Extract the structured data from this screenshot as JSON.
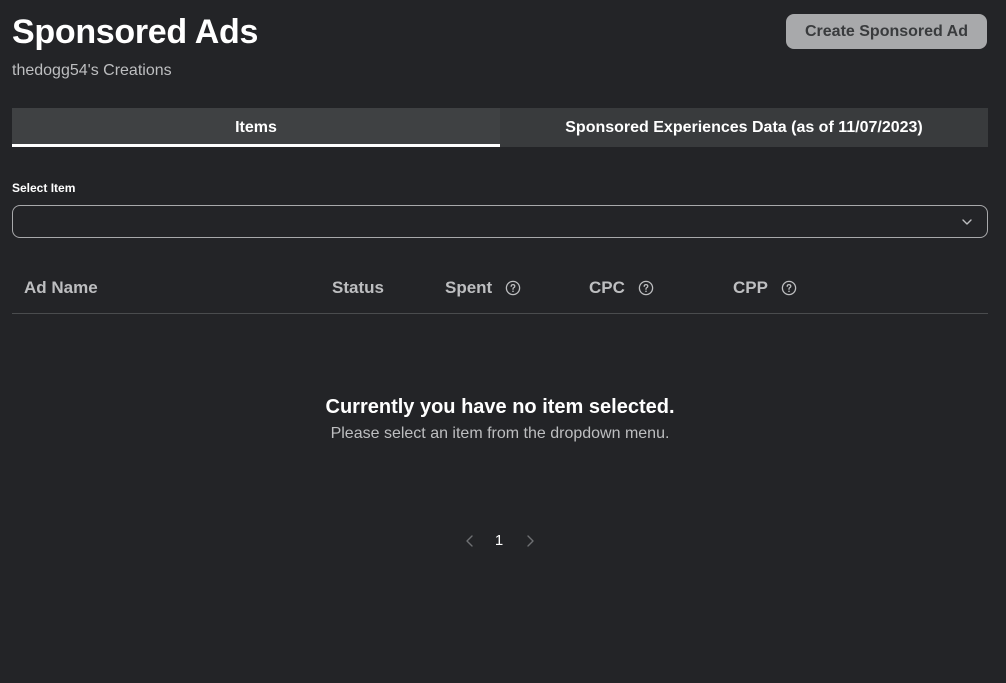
{
  "header": {
    "title": "Sponsored Ads",
    "subtitle": "thedogg54's Creations",
    "create_button_label": "Create Sponsored Ad"
  },
  "tabs": [
    {
      "label": "Items",
      "active": true
    },
    {
      "label": "Sponsored Experiences Data (as of 11/07/2023)",
      "active": false
    }
  ],
  "select": {
    "label": "Select Item",
    "value": ""
  },
  "table": {
    "columns": [
      {
        "label": "Ad Name",
        "help": false
      },
      {
        "label": "Status",
        "help": false
      },
      {
        "label": "Spent",
        "help": true
      },
      {
        "label": "CPC",
        "help": true
      },
      {
        "label": "CPP",
        "help": true
      }
    ]
  },
  "empty_state": {
    "title": "Currently you have no item selected.",
    "message": "Please select an item from the dropdown menu."
  },
  "pagination": {
    "current_page": "1"
  },
  "colors": {
    "background": "#232427",
    "tab_bar": "#393b3d",
    "button_bg": "#a8a9ab",
    "muted_text": "#bdbec0"
  }
}
